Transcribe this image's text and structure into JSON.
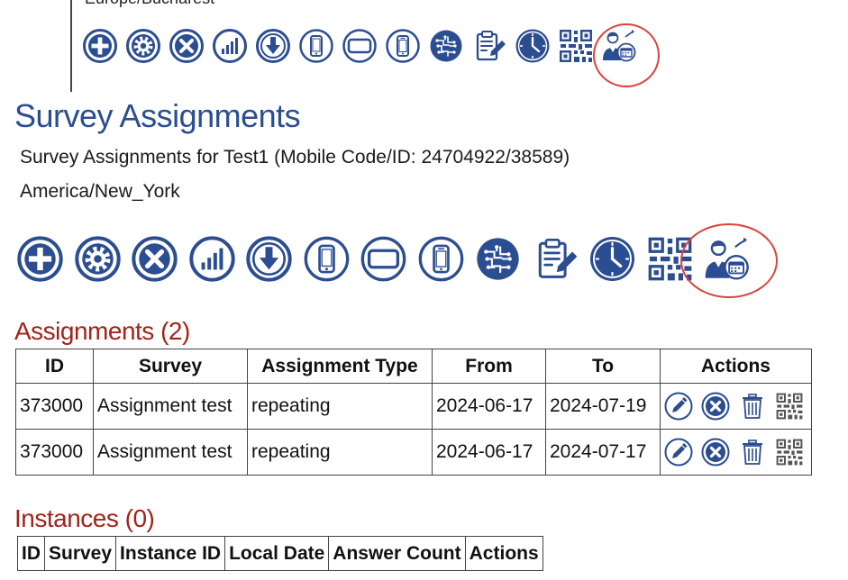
{
  "top": {
    "timezone_cut": "Europe/Bucharest"
  },
  "toolbar_top": {
    "icons": [
      "plus-circle-icon",
      "gear-circle-icon",
      "x-circle-icon",
      "bar-chart-circle-icon",
      "download-circle-icon",
      "phone-portrait-icon",
      "phone-landscape-icon",
      "phone-outline-icon",
      "circuit-brain-icon",
      "clipboard-edit-icon",
      "clock-icon",
      "qr-code-icon",
      "user-calendar-icon"
    ],
    "highlighted": "user-calendar-icon"
  },
  "page": {
    "title": "Survey Assignments",
    "subtitle": "Survey Assignments for Test1 (Mobile Code/ID: 24704922/38589)",
    "timezone": "America/New_York"
  },
  "toolbar_main": {
    "icons": [
      "plus-circle-icon",
      "gear-circle-icon",
      "x-circle-icon",
      "bar-chart-circle-icon",
      "download-circle-icon",
      "phone-portrait-icon",
      "phone-landscape-icon",
      "phone-outline-icon",
      "circuit-brain-icon",
      "clipboard-edit-icon",
      "clock-icon",
      "qr-code-icon",
      "user-calendar-icon"
    ],
    "highlighted": "user-calendar-icon"
  },
  "assignments": {
    "title": "Assignments (2)",
    "columns": [
      "ID",
      "Survey",
      "Assignment Type",
      "From",
      "To",
      "Actions"
    ],
    "rows": [
      {
        "id": "373000",
        "survey": "Assignment test",
        "type": "repeating",
        "from": "2024-06-17",
        "to": "2024-07-19",
        "actions": [
          "edit-icon",
          "delete-x-icon",
          "trash-icon",
          "qr-code-icon"
        ]
      },
      {
        "id": "373000",
        "survey": "Assignment test",
        "type": "repeating",
        "from": "2024-06-17",
        "to": "2024-07-17",
        "actions": [
          "edit-icon",
          "delete-x-icon",
          "trash-icon",
          "qr-code-icon"
        ]
      }
    ]
  },
  "instances": {
    "title": "Instances (0)",
    "columns": [
      "ID",
      "Survey",
      "Instance ID",
      "Local Date",
      "Answer Count",
      "Actions"
    ]
  },
  "colors": {
    "primary_blue": "#2b4d91",
    "section_red": "#a3231b",
    "highlight_ring": "#d9433b"
  }
}
